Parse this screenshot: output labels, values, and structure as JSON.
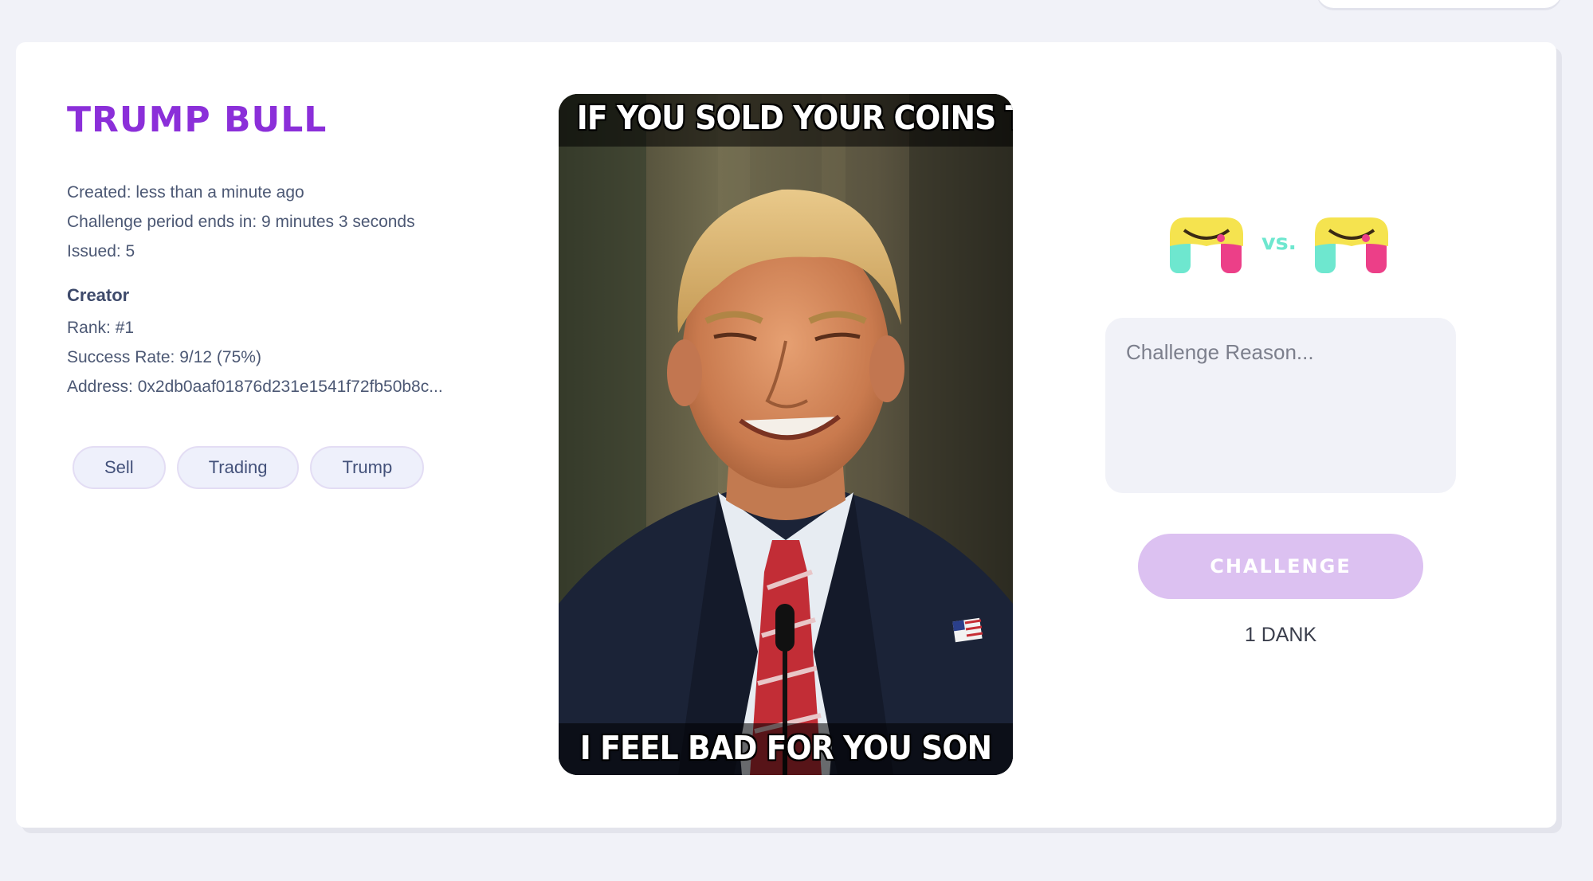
{
  "meme": {
    "title": "TRUMP BULL",
    "created": "Created: less than a minute ago",
    "challenge_period": "Challenge period ends in: 9 minutes 3 seconds",
    "issued": "Issued: 5",
    "top_caption": "IF YOU SOLD YOUR COINS TODAY",
    "bottom_caption": "I FEEL BAD FOR YOU SON"
  },
  "creator": {
    "heading": "Creator",
    "rank": "Rank: #1",
    "success_rate": "Success Rate: 9/12 (75%)",
    "address": "Address: 0x2db0aaf01876d231e1541f72fb50b8c..."
  },
  "tags": [
    "Sell",
    "Trading",
    "Trump"
  ],
  "challenge": {
    "vs_label": "vs.",
    "reason_placeholder": "Challenge Reason...",
    "button_label": "CHALLENGE",
    "price": "1 DANK"
  },
  "colors": {
    "title_purple": "#8b2fd9",
    "button_lilac": "#dcc1f1",
    "logo_yellow": "#f5e34f",
    "logo_teal": "#6ee7cf",
    "logo_pink": "#ec3f88"
  }
}
